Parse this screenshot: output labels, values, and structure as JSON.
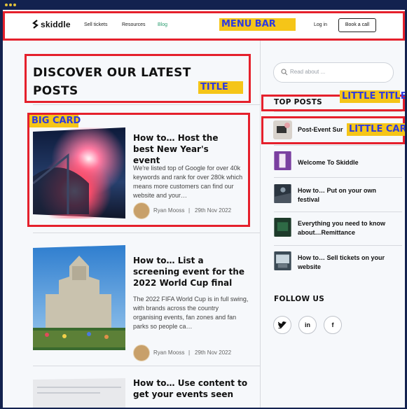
{
  "nav": {
    "logo": "skiddle",
    "links": [
      "Sell tickets",
      "Resources",
      "Blog"
    ],
    "login": "Log in",
    "cta": "Book a call",
    "accent": "#2a9d6f"
  },
  "title": "DISCOVER OUR LATEST POSTS",
  "posts": [
    {
      "title": "How to… Host the best New Year's event",
      "desc": "We're listed top of Google for over 40k keywords and rank for over 280k which means more customers can find our website and your…",
      "author": "Ryan Mooss",
      "date": "29th Nov 2022"
    },
    {
      "title": "How to… List a screening event for the 2022 World Cup final",
      "desc": "The 2022 FIFA World Cup is in full swing, with brands across the country organising events, fan zones and fan parks so people ca…",
      "author": "Ryan Mooss",
      "date": "29th Nov 2022"
    },
    {
      "title": "How to… Use content to get your events seen",
      "desc": "",
      "author": "",
      "date": ""
    }
  ],
  "sidebar": {
    "search_placeholder": "Read about ...",
    "top_posts_title": "TOP POSTS",
    "top_posts": [
      "Post-Event Sur",
      "Welcome To Skiddle",
      "How to… Put on your own festival",
      "Everything you need to know about…Remittance",
      "How to… Sell tickets on your website"
    ],
    "follow_title": "FOLLOW US",
    "social": [
      "twitter-icon",
      "linkedin-icon",
      "facebook-icon"
    ]
  },
  "annotations": {
    "menu_bar": "MENU BAR",
    "title": "TITLE",
    "big_card": "BIG CARD",
    "little_title": "LITTLE TITLE",
    "little_card": "LITTLE CARD"
  },
  "colors": {
    "annotation_border": "#e5202c",
    "annotation_label_bg": "#f5c518",
    "annotation_label_text": "#2e3adf",
    "frame": "#13224f"
  }
}
